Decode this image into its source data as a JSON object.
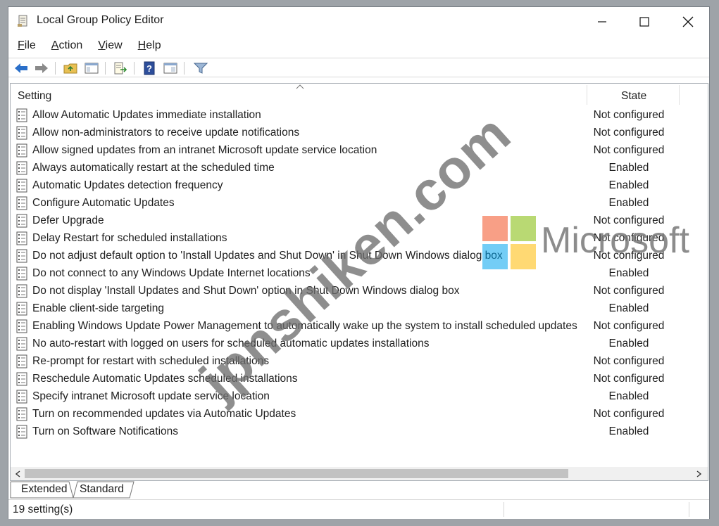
{
  "window": {
    "title": "Local Group Policy Editor"
  },
  "menu": [
    {
      "label": "File",
      "key": "F",
      "rest": "ile"
    },
    {
      "label": "Action",
      "key": "A",
      "rest": "ction"
    },
    {
      "label": "View",
      "key": "V",
      "rest": "iew"
    },
    {
      "label": "Help",
      "key": "H",
      "rest": "elp"
    }
  ],
  "toolbar": [
    "back-icon",
    "forward-icon",
    "up-folder-icon",
    "show-hide-tree-icon",
    "export-list-icon",
    "help-icon",
    "properties-icon",
    "filter-icon"
  ],
  "table": {
    "headers": {
      "setting": "Setting",
      "state": "State"
    },
    "rows": [
      {
        "name": "Allow Automatic Updates immediate installation",
        "state": "Not configured"
      },
      {
        "name": "Allow non-administrators to receive update notifications",
        "state": "Not configured"
      },
      {
        "name": "Allow signed updates from an intranet Microsoft update service location",
        "state": "Not configured"
      },
      {
        "name": "Always automatically restart at the scheduled time",
        "state": "Enabled"
      },
      {
        "name": "Automatic Updates detection frequency",
        "state": "Enabled"
      },
      {
        "name": "Configure Automatic Updates",
        "state": "Enabled"
      },
      {
        "name": "Defer Upgrade",
        "state": "Not configured"
      },
      {
        "name": "Delay Restart for scheduled installations",
        "state": "Not configured"
      },
      {
        "name": "Do not adjust default option to 'Install Updates and Shut Down' in Shut Down Windows dialog box",
        "state": "Not configured"
      },
      {
        "name": "Do not connect to any Windows Update Internet locations",
        "state": "Enabled"
      },
      {
        "name": "Do not display 'Install Updates and Shut Down' option in Shut Down Windows dialog box",
        "state": "Not configured"
      },
      {
        "name": "Enable client-side targeting",
        "state": "Enabled"
      },
      {
        "name": "Enabling Windows Update Power Management to automatically wake up the system to install scheduled updates",
        "state": "Not configured"
      },
      {
        "name": "No auto-restart with logged on users for scheduled automatic updates installations",
        "state": "Enabled"
      },
      {
        "name": "Re-prompt for restart with scheduled installations",
        "state": "Not configured"
      },
      {
        "name": "Reschedule Automatic Updates scheduled installations",
        "state": "Not configured"
      },
      {
        "name": "Specify intranet Microsoft update service location",
        "state": "Enabled"
      },
      {
        "name": "Turn on recommended updates via Automatic Updates",
        "state": "Not configured"
      },
      {
        "name": "Turn on Software Notifications",
        "state": "Enabled"
      }
    ]
  },
  "tabs": [
    {
      "label": "Extended"
    },
    {
      "label": "Standard"
    }
  ],
  "status": {
    "text": "19 setting(s)"
  },
  "watermark": {
    "site": "jpnshiken.com",
    "brand": "Microsoft"
  },
  "colors": {
    "accent_blue": "#2a6fc9",
    "ms_red": "#f25022",
    "ms_green": "#7fba00",
    "ms_blue": "#00a4ef",
    "ms_yellow": "#ffb900"
  }
}
